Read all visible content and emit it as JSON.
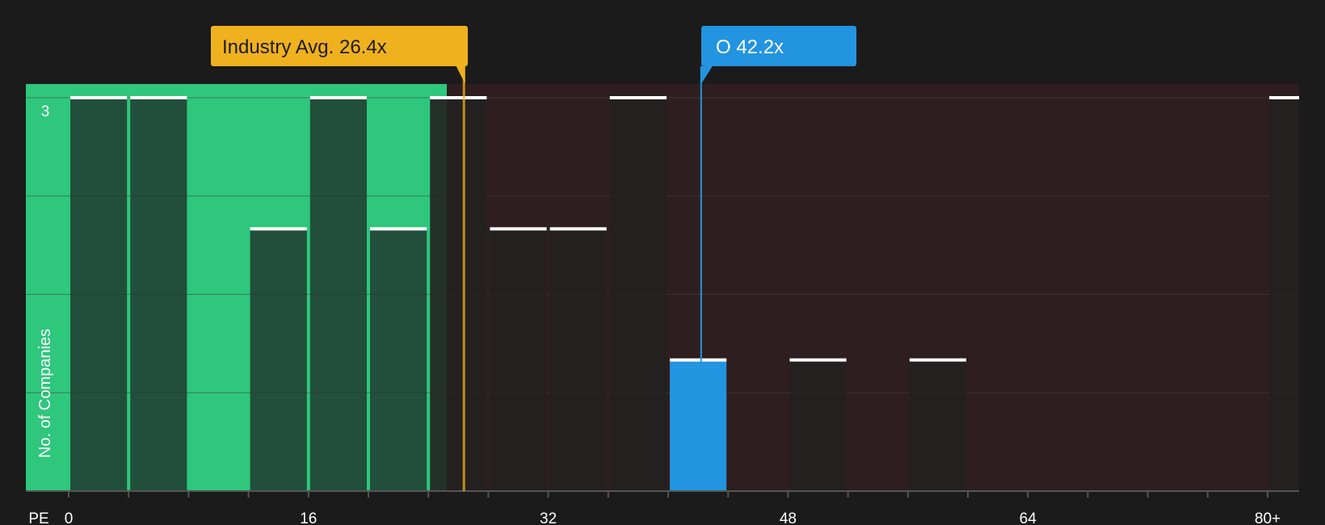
{
  "chart_data": {
    "type": "bar",
    "xlabel": "PE",
    "ylabel": "No. of Companies",
    "x_tick_labels": [
      "0",
      "16",
      "32",
      "48",
      "64",
      "80+"
    ],
    "x_ticks": [
      0,
      16,
      32,
      48,
      64,
      80
    ],
    "xlim": [
      0,
      80
    ],
    "bin_width": 4,
    "ylim": [
      0,
      3
    ],
    "y_tick_labels": [
      "3"
    ],
    "grid": true,
    "bars": [
      {
        "x": 2,
        "value": 3
      },
      {
        "x": 6,
        "value": 3
      },
      {
        "x": 14,
        "value": 2
      },
      {
        "x": 18,
        "value": 3
      },
      {
        "x": 22,
        "value": 2
      },
      {
        "x": 26,
        "value": 3
      },
      {
        "x": 30,
        "value": 2
      },
      {
        "x": 34,
        "value": 2
      },
      {
        "x": 38,
        "value": 3
      },
      {
        "x": 42,
        "value": 1,
        "highlight": true
      },
      {
        "x": 50,
        "value": 1
      },
      {
        "x": 58,
        "value": 1
      },
      {
        "x": 82,
        "value": 3
      }
    ],
    "industry_avg": {
      "value": 26.4,
      "label": "Industry Avg. 26.4x"
    },
    "company": {
      "value": 42.2,
      "label": "O 42.2x"
    },
    "colors": {
      "background": "#1b1b1b",
      "below_avg_zone": "#2ec77c",
      "above_avg_zone": "#2e1e1f",
      "bar_dark": "#1f3a30",
      "bar_neutral": "#242020",
      "bar_highlight": "#2394e0",
      "bar_cap": "#ffffff",
      "industry_callout": "#f0b11e",
      "company_callout": "#2394e0",
      "gridline": "#444444",
      "axis": "#555555"
    }
  }
}
